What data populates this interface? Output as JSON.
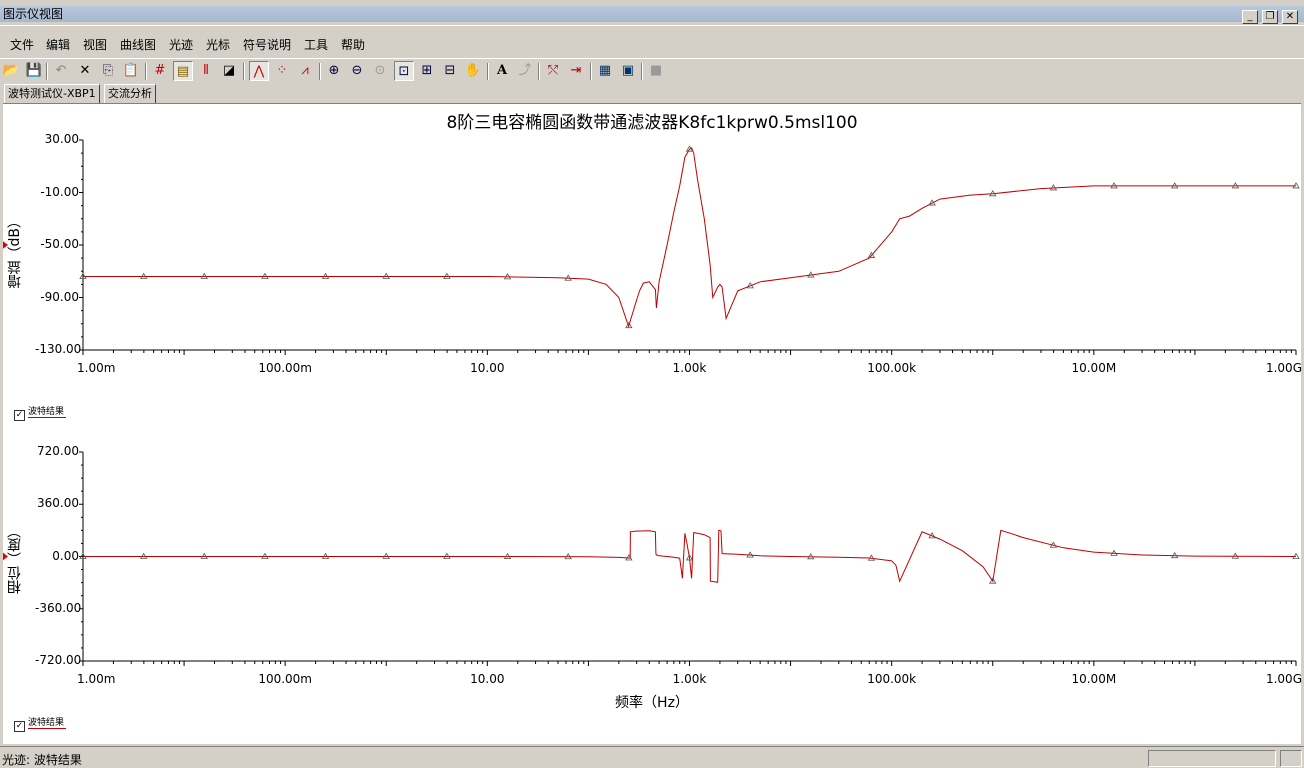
{
  "window": {
    "title": "图示仪视图",
    "min": "_",
    "restore": "❐",
    "close": "✕"
  },
  "menu": [
    "文件",
    "编辑",
    "视图",
    "曲线图",
    "光迹",
    "光标",
    "符号说明",
    "工具",
    "帮助"
  ],
  "tabs": [
    "波特测试仪-XBP1",
    "交流分析"
  ],
  "graph_title": "8阶三电容椭圆函数带通滤波器K8fc1kprw0.5msl100",
  "legend_label": "波特结果",
  "status": "光迹: 波特结果",
  "colors": {
    "trace": "#c00000",
    "background": "#ffffff",
    "chrome": "#d4d0c8"
  },
  "chart_data": [
    {
      "type": "line",
      "name": "magnitude",
      "ylabel": "增益（dB）",
      "xscale": "log",
      "xlim": [
        0.001,
        1000000000
      ],
      "ylim": [
        -130,
        30
      ],
      "yticks": [
        "30.00",
        "-10.00",
        "-50.00",
        "-90.00",
        "-130.00"
      ],
      "xticks": [
        "1.00m",
        "100.00m",
        "10.00",
        "1.00k",
        "100.00k",
        "10.00M",
        "1.00G"
      ],
      "series": [
        {
          "name": "波特结果",
          "x": [
            0.001,
            0.01,
            0.1,
            1,
            10,
            50,
            100,
            150,
            200,
            250,
            300,
            320,
            350,
            400,
            460,
            470,
            500,
            600,
            700,
            800,
            900,
            1000,
            1050,
            1100,
            1200,
            1400,
            1600,
            1700,
            1900,
            2000,
            2100,
            2300,
            3000,
            5000,
            10000,
            30000,
            60000,
            100000,
            120000,
            150000,
            200000,
            300000,
            600000,
            1000000,
            3000000,
            10000000,
            100000000,
            1000000000
          ],
          "y": [
            -74,
            -74,
            -74,
            -74,
            -74,
            -75,
            -76,
            -80,
            -90,
            -112,
            -92,
            -85,
            -79,
            -78,
            -84,
            -98,
            -78,
            -50,
            -25,
            -5,
            17,
            23,
            24,
            20,
            0,
            -30,
            -65,
            -90,
            -82,
            -80,
            -82,
            -106,
            -85,
            -78,
            -75,
            -70,
            -60,
            -40,
            -30,
            -28,
            -22,
            -15,
            -12,
            -11,
            -7,
            -5,
            -5,
            -5
          ]
        }
      ]
    },
    {
      "type": "line",
      "name": "phase",
      "ylabel": "相位（度）",
      "xlabel": "频率（Hz）",
      "xscale": "log",
      "xlim": [
        0.001,
        1000000000
      ],
      "ylim": [
        -720,
        720
      ],
      "yticks": [
        "720.00",
        "360.00",
        "0.00",
        "-360.00",
        "-720.00"
      ],
      "xticks": [
        "1.00m",
        "100.00m",
        "10.00",
        "1.00k",
        "100.00k",
        "10.00M",
        "1.00G"
      ],
      "series": [
        {
          "name": "波特结果",
          "x": [
            0.001,
            0.01,
            0.1,
            1,
            10,
            100,
            200,
            250,
            259,
            260,
            300,
            400,
            460,
            465,
            470,
            500,
            600,
            700,
            800,
            850,
            900,
            950,
            1000,
            1050,
            1100,
            1200,
            1400,
            1500,
            1600,
            1610,
            1800,
            1900,
            1950,
            2000,
            2050,
            2100,
            3000,
            5000,
            10000,
            30000,
            60000,
            100000,
            110000,
            120000,
            200000,
            300000,
            500000,
            800000,
            1000000,
            1200000,
            1500000,
            2000000,
            5000000,
            10000000,
            30000000,
            100000000,
            1000000000
          ],
          "y": [
            0,
            0,
            0,
            0,
            0,
            -2,
            -6,
            -10,
            -12,
            170,
            175,
            178,
            170,
            20,
            10,
            5,
            0,
            -5,
            -12,
            -150,
            160,
            80,
            -10,
            -150,
            165,
            160,
            150,
            140,
            130,
            -170,
            -175,
            -178,
            180,
            180,
            175,
            20,
            15,
            5,
            0,
            -5,
            -10,
            -30,
            -60,
            -170,
            170,
            120,
            40,
            -70,
            -170,
            180,
            160,
            130,
            60,
            30,
            10,
            3,
            0
          ]
        }
      ]
    }
  ]
}
